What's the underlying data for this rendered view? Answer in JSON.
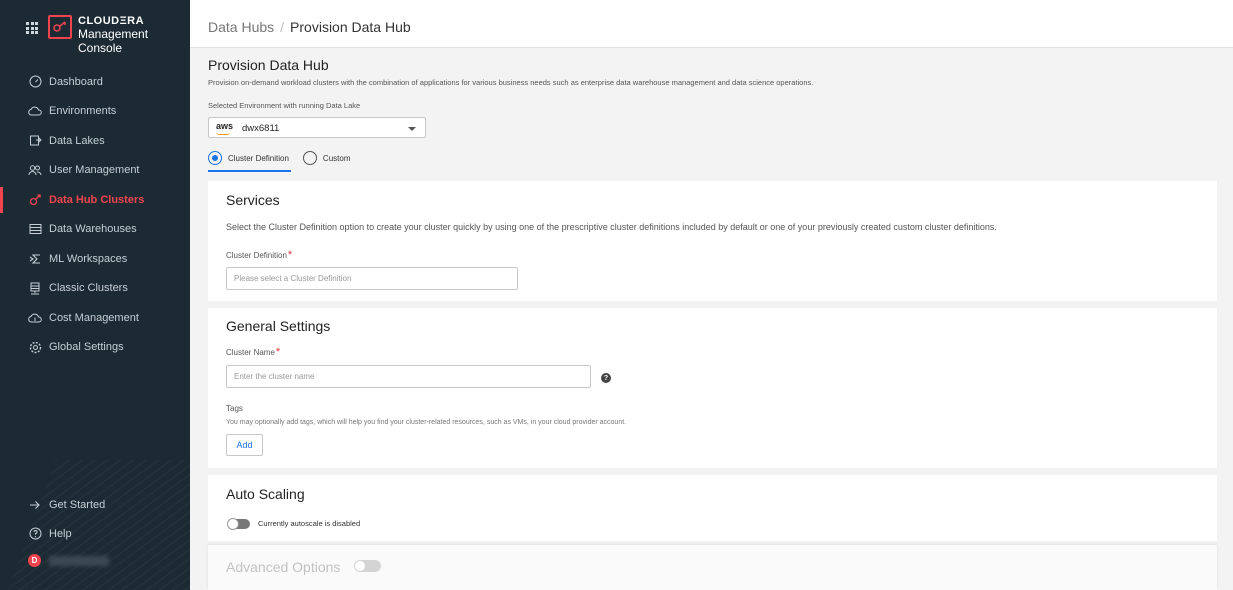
{
  "brand": {
    "name": "CLOUDΞRA",
    "subtitle": "Management Console"
  },
  "sidebar": {
    "items": [
      {
        "label": "Dashboard",
        "icon": "dashboard-gauge-icon"
      },
      {
        "label": "Environments",
        "icon": "cloud-icon"
      },
      {
        "label": "Data Lakes",
        "icon": "data-lake-icon"
      },
      {
        "label": "User Management",
        "icon": "users-icon"
      },
      {
        "label": "Data Hub Clusters",
        "icon": "data-hub-icon",
        "active": true
      },
      {
        "label": "Data Warehouses",
        "icon": "data-warehouse-icon"
      },
      {
        "label": "ML Workspaces",
        "icon": "ml-workspace-icon"
      },
      {
        "label": "Classic Clusters",
        "icon": "server-icon"
      },
      {
        "label": "Cost Management",
        "icon": "cost-cloud-icon"
      },
      {
        "label": "Global Settings",
        "icon": "gear-icon"
      }
    ],
    "bottom": [
      {
        "label": "Get Started",
        "icon": "arrow-right-icon"
      },
      {
        "label": "Help",
        "icon": "help-circle-icon"
      }
    ],
    "user": {
      "avatar_letter": "D"
    }
  },
  "header": {
    "breadcrumb_parent": "Data Hubs",
    "separator": "/",
    "breadcrumb_current": "Provision Data Hub"
  },
  "main": {
    "title": "Provision Data Hub",
    "description": "Provision on-demand workload clusters with the combination of applications for various business needs such as enterprise data warehouse management and data science operations.",
    "env_label": "Selected Environment with running Data Lake",
    "env_provider": "aws",
    "env_value": "dwx6811",
    "radio_options": [
      {
        "label": "Cluster Definition",
        "selected": true
      },
      {
        "label": "Custom",
        "selected": false
      }
    ]
  },
  "services": {
    "title": "Services",
    "description": "Select the Cluster Definition option to create your cluster quickly by using one of the prescriptive cluster definitions included by default or one of your previously created custom cluster definitions.",
    "field_label": "Cluster Definition",
    "required_mark": "*",
    "placeholder": "Please select a Cluster Definition"
  },
  "general": {
    "title": "General Settings",
    "name_label": "Cluster Name",
    "required_mark": "*",
    "name_placeholder": "Enter the cluster name",
    "help_glyph": "?",
    "tags_label": "Tags",
    "tags_description": "You may optionally add tags, which will help you find your cluster-related resources, such as VMs, in your cloud provider account.",
    "add_label": "Add"
  },
  "autoscaling": {
    "title": "Auto Scaling",
    "status": "Currently autoscale is disabled",
    "enabled": false
  },
  "advanced": {
    "title": "Advanced Options",
    "enabled": false
  },
  "colors": {
    "sidebar_bg": "#1c2a33",
    "accent": "#f0444f",
    "link_blue": "#1a73e8",
    "page_bg": "#f3f3f3"
  }
}
